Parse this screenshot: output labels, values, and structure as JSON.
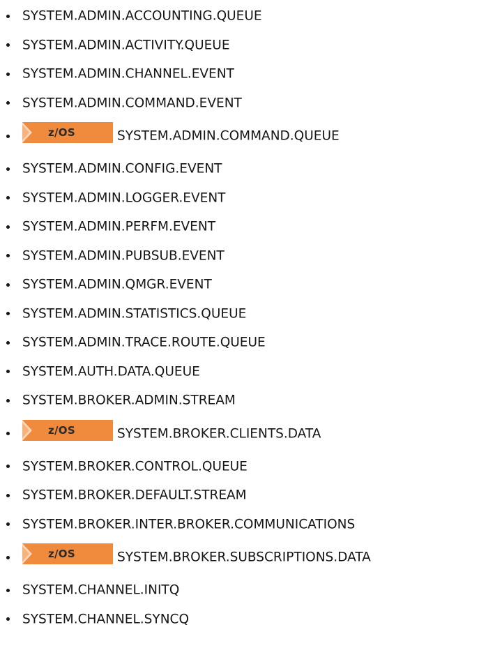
{
  "badge_label": "z/OS",
  "colors": {
    "badge": "#f08a3c",
    "text": "#161616"
  },
  "queues": [
    {
      "name": "SYSTEM.ADMIN.ACCOUNTING.QUEUE",
      "zos": false
    },
    {
      "name": "SYSTEM.ADMIN.ACTIVITY.QUEUE",
      "zos": false
    },
    {
      "name": "SYSTEM.ADMIN.CHANNEL.EVENT",
      "zos": false
    },
    {
      "name": "SYSTEM.ADMIN.COMMAND.EVENT",
      "zos": false
    },
    {
      "name": "SYSTEM.ADMIN.COMMAND.QUEUE",
      "zos": true
    },
    {
      "name": "SYSTEM.ADMIN.CONFIG.EVENT",
      "zos": false
    },
    {
      "name": "SYSTEM.ADMIN.LOGGER.EVENT",
      "zos": false
    },
    {
      "name": "SYSTEM.ADMIN.PERFM.EVENT",
      "zos": false
    },
    {
      "name": "SYSTEM.ADMIN.PUBSUB.EVENT",
      "zos": false
    },
    {
      "name": "SYSTEM.ADMIN.QMGR.EVENT",
      "zos": false
    },
    {
      "name": "SYSTEM.ADMIN.STATISTICS.QUEUE",
      "zos": false
    },
    {
      "name": "SYSTEM.ADMIN.TRACE.ROUTE.QUEUE",
      "zos": false
    },
    {
      "name": "SYSTEM.AUTH.DATA.QUEUE",
      "zos": false
    },
    {
      "name": "SYSTEM.BROKER.ADMIN.STREAM",
      "zos": false
    },
    {
      "name": "SYSTEM.BROKER.CLIENTS.DATA",
      "zos": true
    },
    {
      "name": "SYSTEM.BROKER.CONTROL.QUEUE",
      "zos": false
    },
    {
      "name": "SYSTEM.BROKER.DEFAULT.STREAM",
      "zos": false
    },
    {
      "name": "SYSTEM.BROKER.INTER.BROKER.COMMUNICATIONS",
      "zos": false
    },
    {
      "name": "SYSTEM.BROKER.SUBSCRIPTIONS.DATA",
      "zos": true
    },
    {
      "name": "SYSTEM.CHANNEL.INITQ",
      "zos": false
    },
    {
      "name": "SYSTEM.CHANNEL.SYNCQ",
      "zos": false
    }
  ]
}
